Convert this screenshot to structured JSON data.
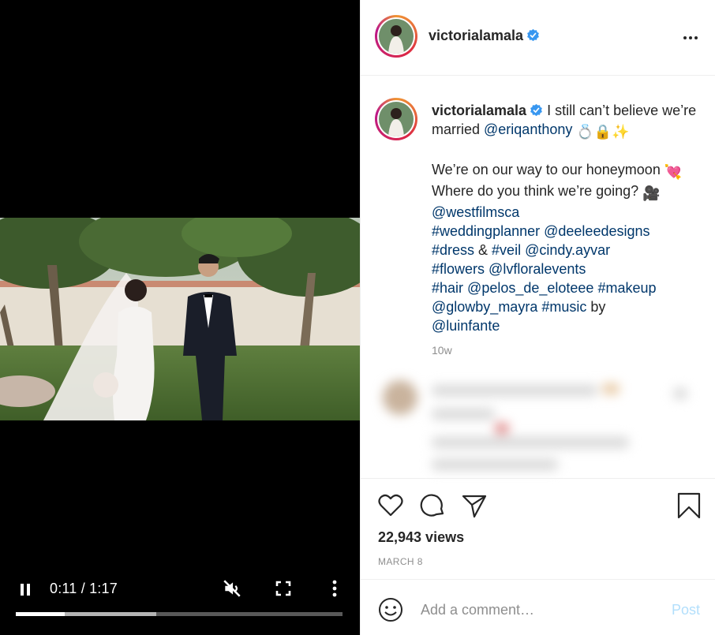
{
  "video": {
    "time": "0:11 / 1:17",
    "progress_played": 0.15,
    "progress_buffered": 0.43,
    "muted": true
  },
  "post": {
    "username": "victorialamala",
    "verified": true
  },
  "caption": {
    "line1_text": " I still can’t believe we’re married ",
    "mention_husband": "@eriqanthony",
    "line1_emojis": "💍🔒✨",
    "para2_text1": "We’re on our way to our honeymoon ",
    "para2_emoji1": "💘",
    "para2_text2": " Where do you think we’re going? ",
    "para2_emoji2": "🎥",
    "t_space": " ",
    "t_amp": " & ",
    "t_by": " by ",
    "mention_films": "@westfilmsca",
    "tag_weddingplanner": "#weddingplanner",
    "mention_deelee": "@deeleedesigns",
    "tag_dress": "#dress",
    "tag_veil": "#veil",
    "mention_cindy": "@cindy.ayvar",
    "tag_flowers": "#flowers",
    "mention_floral": "@lvfloralevents",
    "tag_hair": "#hair",
    "mention_pelos": "@pelos_de_eloteee",
    "tag_makeup": "#makeup",
    "mention_glowby": "@glowby_mayra",
    "tag_music": "#music",
    "mention_luinfante": "@luinfante",
    "time_ago": "10w"
  },
  "actions": {
    "views": "22,943 views",
    "date": "MARCH 8"
  },
  "comment_box": {
    "placeholder": "Add a comment…",
    "post_label": "Post"
  },
  "colors": {
    "link": "#00376b",
    "verified": "#3897f0",
    "post_disabled": "#b2dffc"
  }
}
